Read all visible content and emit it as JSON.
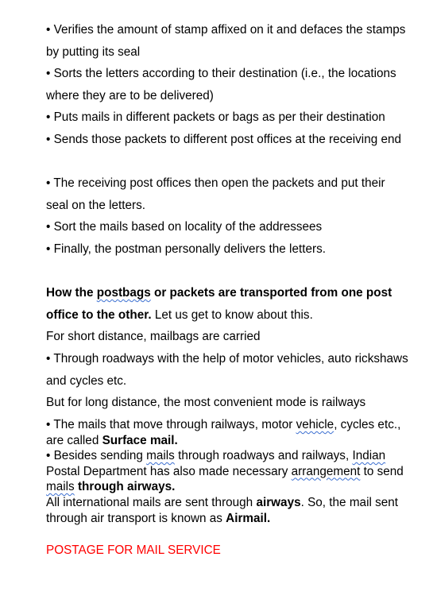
{
  "bullet": "•",
  "steps": [
    "Verifies the amount of stamp affixed on it and defaces the stamps by putting its seal",
    "Sorts the letters according to their destination (i.e., the locations where they are to be delivered)",
    "Puts mails in different packets or bags as per their destination",
    "Sends those packets to different post offices at the receiving end",
    "The receiving post offices then open the packets and put their seal on the letters.",
    "Sort the mails based on locality of the addressees",
    "Finally, the postman personally delivers the letters."
  ],
  "transport": {
    "heading_pre": "How the ",
    "heading_sq": "postbags",
    "heading_post": " or packets are transported from one post office to the other.",
    "heading_tail": " Let us get to know about this.",
    "short_intro": "For short distance, mailbags are carried",
    "short_bullet": "Through roadways with the help of motor vehicles, auto rickshaws and cycles etc.",
    "long_intro": "But for long distance, the most convenient mode is railways"
  },
  "surface": {
    "pre": "The mails that move through railways, motor ",
    "sq": "vehicle",
    "mid": ", cycles etc., are called ",
    "bold": "Surface mail."
  },
  "airway": {
    "pre": "Besides sending ",
    "sq1": "mails",
    "mid1": " through roadways and railways, ",
    "sq2": "Indian",
    "mid2": " Postal Department has also made necessary ",
    "sq3": "arrangement",
    "mid3": " to send ",
    "sq4": "mails",
    "space": " ",
    "bold": "through airways."
  },
  "airmail": {
    "pre": "All international mails are sent through ",
    "bold1": "airways",
    "mid": ". So, the mail sent through air transport is known as ",
    "bold2": "Airmail."
  },
  "section_heading": "POSTAGE FOR MAIL SERVICE",
  "colors": {
    "text": "#000000",
    "heading_red": "#ff0000",
    "spellcheck": "#3b6fd1"
  }
}
